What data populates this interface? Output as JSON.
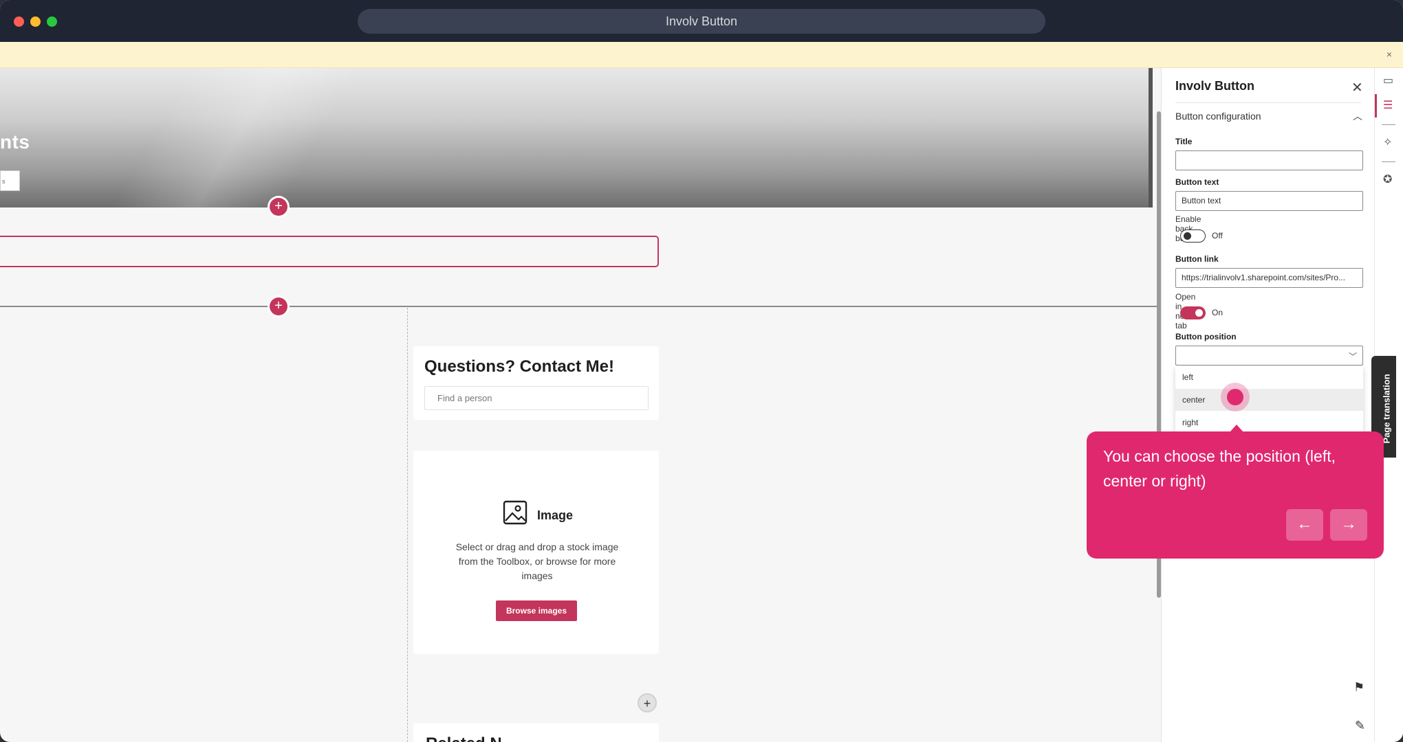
{
  "window": {
    "title": "Involv Button"
  },
  "notice": {
    "close_glyph": "×"
  },
  "hero": {
    "title": "nts",
    "button_label": "s"
  },
  "canvas": {
    "add_glyph": "+",
    "contact_card": {
      "title": "Questions? Contact Me!",
      "search_placeholder": "Find a person"
    },
    "image_card": {
      "label": "Image",
      "description": "Select or drag and drop a stock image from the Toolbox, or browse for more images",
      "browse_label": "Browse images"
    },
    "add_section_glyph": "+",
    "bottom_card_title": "Related N"
  },
  "pane": {
    "title": "Involv Button",
    "close_glyph": "✕",
    "section_title": "Button configuration",
    "fields": {
      "title_label": "Title",
      "title_value": "",
      "button_text_label": "Button text",
      "button_text_value": "Button text",
      "back_button_label": "Enable back button",
      "back_button_state": "Off",
      "link_label": "Button link",
      "link_value": "https://trialinvolv1.sharepoint.com/sites/Pro...",
      "new_tab_label": "Open in new tab",
      "new_tab_state": "On",
      "position_label": "Button position",
      "position_value": ""
    },
    "position_options": [
      "left",
      "center",
      "right"
    ],
    "selected_option": "center"
  },
  "rail": {
    "page_translation_label": "Page translation"
  },
  "tooltip": {
    "text": "You can choose the position (left, center or right)",
    "prev_glyph": "←",
    "next_glyph": "→"
  },
  "colors": {
    "accent": "#c3355a",
    "tooltip": "#e0286e",
    "titlebar": "#1f2533"
  }
}
